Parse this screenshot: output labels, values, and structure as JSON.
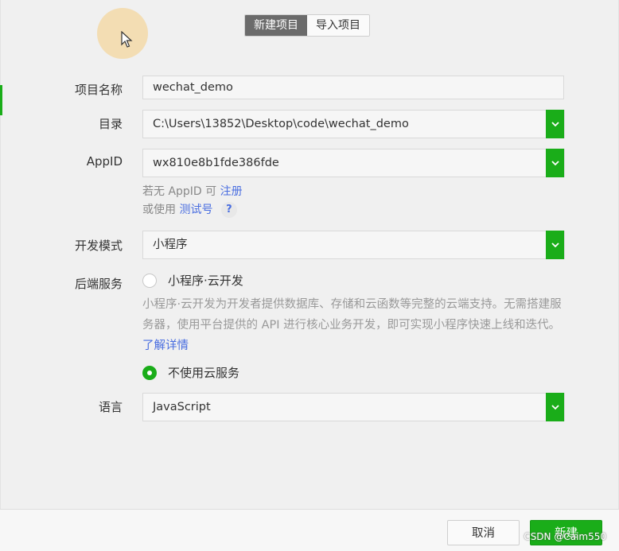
{
  "tabs": [
    {
      "label": "新建项目",
      "active": true
    },
    {
      "label": "导入项目",
      "active": false
    }
  ],
  "form": {
    "project_name": {
      "label": "项目名称",
      "value": "wechat_demo"
    },
    "directory": {
      "label": "目录",
      "value": "C:\\Users\\13852\\Desktop\\code\\wechat_demo"
    },
    "appid": {
      "label": "AppID",
      "value": "wx810e8b1fde386fde"
    },
    "appid_hint": {
      "prefix": "若无 AppID 可",
      "register_link": "注册",
      "or_use": "或使用",
      "test_link": "测试号",
      "help": "?"
    },
    "dev_mode": {
      "label": "开发模式",
      "value": "小程序"
    },
    "backend": {
      "label": "后端服务",
      "option_cloud": "小程序·云开发",
      "cloud_desc": "小程序·云开发为开发者提供数据库、存储和云函数等完整的云端支持。无需搭建服务器，使用平台提供的 API 进行核心业务开发，即可实现小程序快速上线和迭代。",
      "learn_more": "了解详情",
      "option_none": "不使用云服务",
      "selected": "不使用云服务"
    },
    "language": {
      "label": "语言",
      "value": "JavaScript"
    }
  },
  "footer": {
    "cancel": "取消",
    "create": "新建"
  },
  "watermark": "CSDN @Caim550",
  "colors": {
    "accent": "#1aad19",
    "link": "#4a6ee0",
    "tab_active": "#6b6b6b"
  }
}
